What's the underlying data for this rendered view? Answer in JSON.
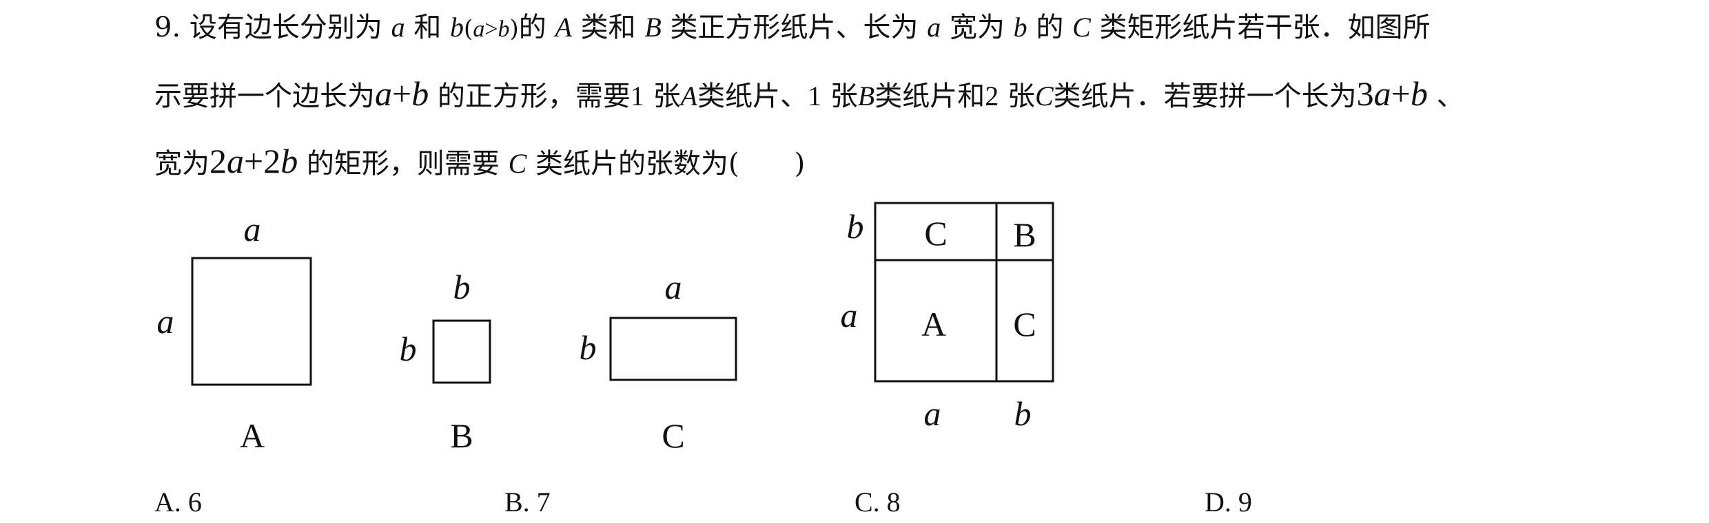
{
  "question": {
    "line1": {
      "num": "9.",
      "p1": "设有边长分别为",
      "v_a": "a",
      "p2": "和",
      "v_b": "b",
      "paren_open": "(",
      "cond_a": "a",
      "cond_gt": ">",
      "cond_b": "b",
      "paren_close": ")",
      "p3": "的",
      "v_A": "A",
      "p4": "类和",
      "v_B": "B",
      "p5": "类正方形纸片、长为",
      "v_a2": "a",
      "p6": "宽为",
      "v_b2": "b",
      "p7": "的",
      "v_C": "C",
      "p8": "类矩形纸片若干张．如图所"
    },
    "line2": {
      "p1": "示要拼一个边长为",
      "expr_a": "a",
      "expr_plus": "+",
      "expr_b": "b",
      "p2": "的正方形，需要",
      "n1": "1",
      "p3": "张",
      "v_A": "A",
      "p4": "类纸片、",
      "n2": "1",
      "p5": "张",
      "v_B": "B",
      "p6": "类纸片和",
      "n3": "2",
      "p7": "张",
      "v_C": "C",
      "p8": "类纸片．若要拼一个长为",
      "expr2_3": "3",
      "expr2_a": "a",
      "expr2_plus": "+",
      "expr2_b": "b",
      "p9": "、"
    },
    "line3": {
      "p1": "宽为",
      "expr_2a": "2",
      "expr_a": "a",
      "expr_plus": "+",
      "expr_2b": "2",
      "expr_b": "b",
      "p2": "的矩形，则需要",
      "v_C": "C",
      "p3": "类纸片的张数为(　　)"
    }
  },
  "figure": {
    "A": {
      "top": "a",
      "left": "a",
      "name": "A"
    },
    "B": {
      "top": "b",
      "left": "b",
      "name": "B"
    },
    "C": {
      "top": "a",
      "left": "b",
      "name": "C"
    },
    "composite": {
      "left_top": "b",
      "left_mid": "a",
      "bottom_left": "a",
      "bottom_right": "b",
      "cell_tl": "C",
      "cell_tr": "B",
      "cell_bl": "A",
      "cell_br": "C"
    }
  },
  "options": [
    "A. 6",
    "B. 7",
    "C. 8",
    "D. 9"
  ]
}
